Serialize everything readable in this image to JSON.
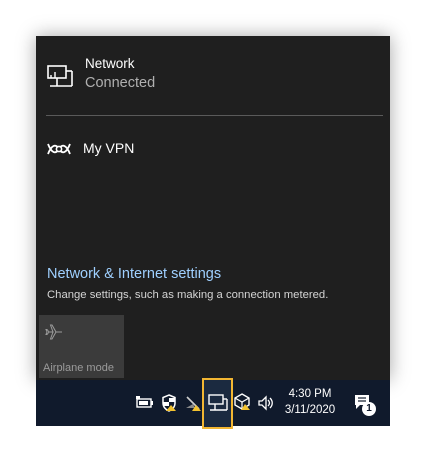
{
  "flyout": {
    "network": {
      "title": "Network",
      "status": "Connected",
      "icon": "wired-network-icon"
    },
    "vpn": {
      "title": "My VPN",
      "icon": "vpn-icon"
    },
    "settings_link": "Network & Internet settings",
    "settings_description": "Change settings, such as making a connection metered.",
    "quick_actions": [
      {
        "label": "Airplane mode",
        "icon": "airplane-icon",
        "state": "off"
      }
    ]
  },
  "taskbar": {
    "tray_icons": [
      "battery-icon",
      "shield-icon",
      "slash-icon",
      "network-icon",
      "cube-icon",
      "volume-icon"
    ],
    "clock": {
      "time": "4:30 PM",
      "date": "3/11/2020"
    },
    "notifications": {
      "count": "1",
      "icon": "action-center-icon"
    }
  },
  "colors": {
    "flyout_bg": "#1f1f1f",
    "taskbar_bg": "#101a2c",
    "link": "#9fd0ff",
    "highlight": "#f2b632"
  }
}
